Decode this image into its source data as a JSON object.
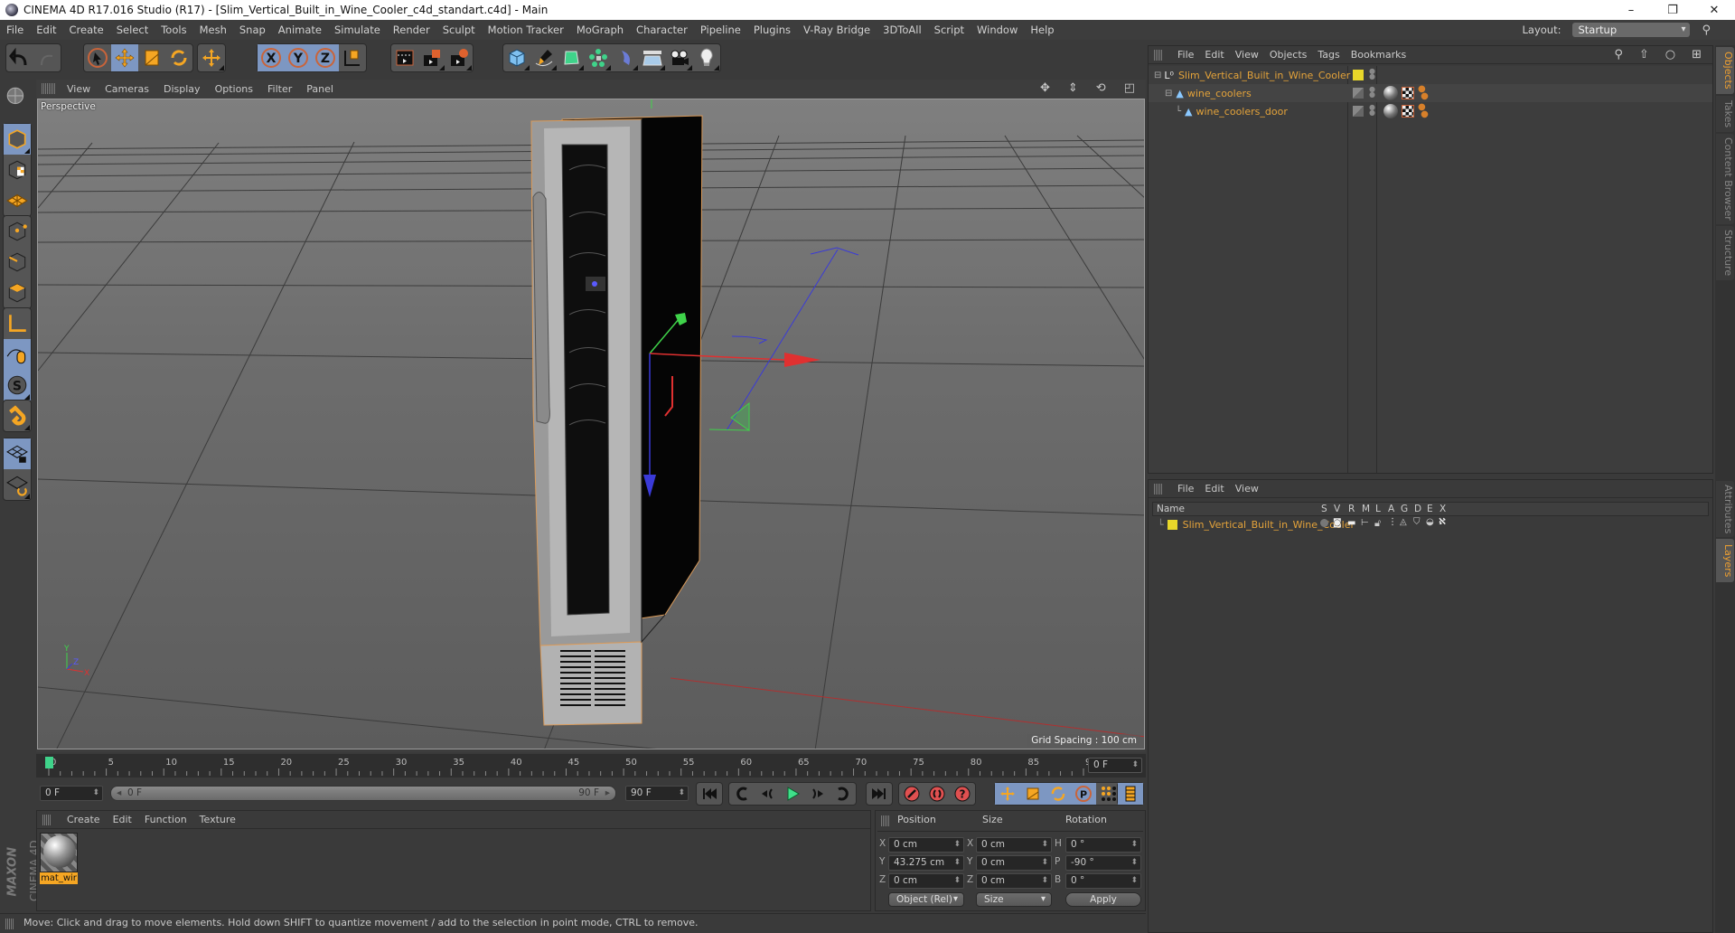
{
  "window": {
    "title": "CINEMA 4D R17.016 Studio (R17) - [Slim_Vertical_Built_in_Wine_Cooler_c4d_standart.c4d] - Main",
    "controls": {
      "minimize": "–",
      "maximize": "❐",
      "close": "✕"
    }
  },
  "menubar": {
    "items": [
      "File",
      "Edit",
      "Create",
      "Select",
      "Tools",
      "Mesh",
      "Snap",
      "Animate",
      "Simulate",
      "Render",
      "Sculpt",
      "Motion Tracker",
      "MoGraph",
      "Character",
      "Pipeline",
      "Plugins",
      "V-Ray Bridge",
      "3DToAll",
      "Script",
      "Window",
      "Help"
    ],
    "layout_label": "Layout:",
    "layout_value": "Startup"
  },
  "toolbar": {
    "groups": [
      [
        "undo-icon",
        "redo-icon"
      ],
      [
        "live-selection-icon",
        "move-icon",
        "scale-icon",
        "rotate-icon"
      ],
      [
        "move-icon"
      ],
      [
        "x-axis-icon",
        "y-axis-icon",
        "z-axis-icon",
        "world-coordinates-icon"
      ],
      [
        "render-view-icon",
        "render-picture-viewer-icon",
        "render-settings-icon"
      ],
      [
        "cube-icon",
        "pen-icon",
        "subdivision-icon",
        "cloner-icon",
        "deformer-icon",
        "floor-icon",
        "camera-icon",
        "light-icon"
      ]
    ]
  },
  "left_tools": [
    "viewport-solo-icon",
    "model-mode-icon",
    "texture-mode-icon",
    "workplane-icon",
    "points-mode-icon",
    "edges-mode-icon",
    "polygons-mode-icon",
    "axis-mode-icon",
    "tweak-mode-icon",
    "soft-selection-icon",
    "snap-icon",
    "workplane-lock-icon",
    "workplane-align-icon"
  ],
  "viewport": {
    "menu": [
      "View",
      "Cameras",
      "Display",
      "Options",
      "Filter",
      "Panel"
    ],
    "label": "Perspective",
    "grid_spacing": "Grid Spacing : 100 cm",
    "nav_icons": [
      "✥",
      "⇕",
      "⟲",
      "◰"
    ],
    "axis_labels": {
      "x": "X",
      "y": "Y",
      "z": "Z"
    }
  },
  "timeline": {
    "ticks": [
      "0",
      "5",
      "10",
      "15",
      "20",
      "25",
      "30",
      "35",
      "40",
      "45",
      "50",
      "55",
      "60",
      "65",
      "70",
      "75",
      "80",
      "85",
      "90"
    ],
    "current_frame": "0 F",
    "start_field": "0 F",
    "range_start": "0 F",
    "range_end": "90 F",
    "end_field": "90 F"
  },
  "transport": {
    "play_buttons": [
      "go-to-start-icon",
      "prev-key-icon",
      "step-back-icon",
      "play-icon",
      "step-forward-icon",
      "next-key-icon",
      "go-to-end-icon"
    ],
    "record_buttons": [
      "record-keys-icon",
      "auto-key-icon",
      "keyframe-selection-icon"
    ],
    "key_buttons": [
      "key-position-icon",
      "key-scale-icon",
      "key-rotation-icon",
      "key-parameter-icon",
      "key-pla-icon"
    ],
    "timeline_button": "timeline-icon"
  },
  "material_manager": {
    "menu": [
      "Create",
      "Edit",
      "Function",
      "Texture"
    ],
    "materials": [
      {
        "name": "mat_wir"
      }
    ]
  },
  "branding": {
    "maxon": "MAXON",
    "product": "CINEMA 4D"
  },
  "coordinates": {
    "headers": {
      "position": "Position",
      "size": "Size",
      "rotation": "Rotation"
    },
    "position": [
      {
        "axis": "X",
        "value": "0 cm"
      },
      {
        "axis": "Y",
        "value": "43.275 cm"
      },
      {
        "axis": "Z",
        "value": "0 cm"
      }
    ],
    "size": [
      {
        "axis": "X",
        "value": "0 cm"
      },
      {
        "axis": "Y",
        "value": "0 cm"
      },
      {
        "axis": "Z",
        "value": "0 cm"
      }
    ],
    "rotation": [
      {
        "axis": "H",
        "value": "0 °"
      },
      {
        "axis": "P",
        "value": "-90 °"
      },
      {
        "axis": "B",
        "value": "0 °"
      }
    ],
    "mode_dropdown": "Object (Rel)",
    "size_dropdown": "Size",
    "apply_label": "Apply"
  },
  "status_bar": "Move: Click and drag to move elements. Hold down SHIFT to quantize movement / add to the selection in point mode, CTRL to remove.",
  "object_manager": {
    "menu": [
      "File",
      "Edit",
      "View",
      "Objects",
      "Tags",
      "Bookmarks"
    ],
    "objects": [
      {
        "name": "Slim_Vertical_Built_in_Wine_Cooler",
        "type": "null",
        "level": 0,
        "layer_color": "#e8d72a"
      },
      {
        "name": "wine_coolers",
        "type": "polygon",
        "level": 1
      },
      {
        "name": "wine_coolers_door",
        "type": "polygon",
        "level": 2
      }
    ]
  },
  "layer_manager": {
    "menu": [
      "File",
      "Edit",
      "View"
    ],
    "columns": [
      "Name",
      "S",
      "V",
      "R",
      "M",
      "L",
      "A",
      "G",
      "D",
      "E",
      "X"
    ],
    "layers": [
      {
        "name": "Slim_Vertical_Built_in_Wine_Cooler",
        "color": "#e8d72a"
      }
    ]
  },
  "side_tabs": {
    "top": [
      {
        "label": "Objects",
        "active": true
      },
      {
        "label": "Takes",
        "active": false
      },
      {
        "label": "Content Browser",
        "active": false
      },
      {
        "label": "Structure",
        "active": false
      }
    ],
    "bottom": [
      {
        "label": "Attributes",
        "active": false
      },
      {
        "label": "Layers",
        "active": true
      }
    ]
  },
  "colors": {
    "accent": "#f0a030",
    "selected_tool": "#7d97c2",
    "object_name": "#e4a33a",
    "layer_yellow": "#e8d72a"
  }
}
